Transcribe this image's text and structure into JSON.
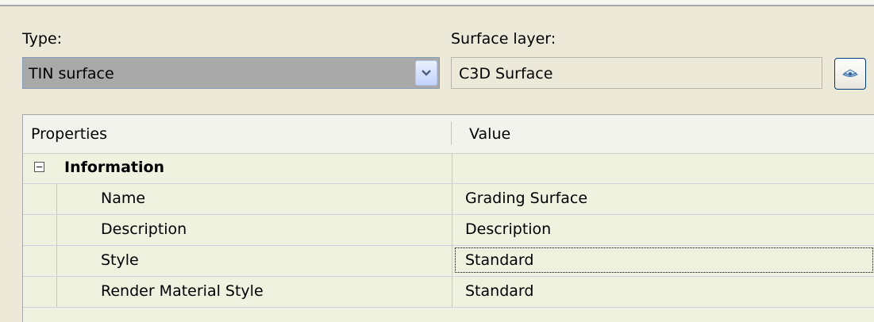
{
  "type_field": {
    "label": "Type:",
    "value": "TIN surface"
  },
  "surface_layer": {
    "label": "Surface layer:",
    "value": "C3D Surface"
  },
  "grid": {
    "columns": [
      "Properties",
      "Value"
    ],
    "category": "Information",
    "rows": [
      {
        "property": "Name",
        "value": "Grading Surface"
      },
      {
        "property": "Description",
        "value": "Description"
      },
      {
        "property": "Style",
        "value": "Standard"
      },
      {
        "property": "Render Material Style",
        "value": "Standard"
      }
    ]
  },
  "icons": {
    "dropdown": "chevron-down-icon",
    "layer_picker": "layer-icon",
    "collapse": "minus-box-icon"
  },
  "colors": {
    "dialog_bg": "#ece9d8",
    "grid_bg": "#eef2df",
    "combo_bg": "#a9a9a9",
    "row_separator": "#d2cfe2",
    "column_separator": "#f0b7b0"
  }
}
